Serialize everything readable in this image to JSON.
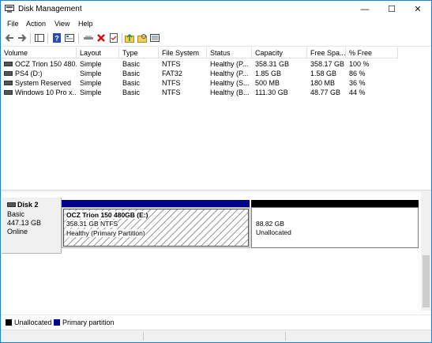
{
  "window": {
    "title": "Disk Management",
    "controls": {
      "minimize": "—",
      "maximize": "☐",
      "close": "✕"
    }
  },
  "menu": [
    "File",
    "Action",
    "View",
    "Help"
  ],
  "toolbar": {
    "icons": [
      "back-icon",
      "forward-icon",
      "show-hide-console-tree-icon",
      "help-icon",
      "properties-icon",
      "connect-icon",
      "delete-icon",
      "check-icon",
      "folder-up-icon",
      "folder-search-icon",
      "list-icon"
    ]
  },
  "table": {
    "columns": [
      "Volume",
      "Layout",
      "Type",
      "File System",
      "Status",
      "Capacity",
      "Free Spa...",
      "% Free"
    ],
    "rows": [
      {
        "volume": "OCZ Trion 150 480...",
        "layout": "Simple",
        "type": "Basic",
        "fs": "NTFS",
        "status": "Healthy (P...",
        "capacity": "358.31 GB",
        "free": "358.17 GB",
        "pct": "100 %"
      },
      {
        "volume": "PS4 (D:)",
        "layout": "Simple",
        "type": "Basic",
        "fs": "FAT32",
        "status": "Healthy (P...",
        "capacity": "1.85 GB",
        "free": "1.58 GB",
        "pct": "86 %"
      },
      {
        "volume": "System Reserved",
        "layout": "Simple",
        "type": "Basic",
        "fs": "NTFS",
        "status": "Healthy (S...",
        "capacity": "500 MB",
        "free": "180 MB",
        "pct": "36 %"
      },
      {
        "volume": "Windows 10 Pro x...",
        "layout": "Simple",
        "type": "Basic",
        "fs": "NTFS",
        "status": "Healthy (B...",
        "capacity": "111.30 GB",
        "free": "48.77 GB",
        "pct": "44 %"
      }
    ]
  },
  "disk": {
    "name": "Disk 2",
    "type": "Basic",
    "size": "447.13 GB",
    "state": "Online",
    "partitions": [
      {
        "title": "OCZ Trion 150 480GB  (E:)",
        "size_fs": "358.31 GB NTFS",
        "status": "Healthy (Primary Partition)"
      },
      {
        "size": "88.82 GB",
        "label": "Unallocated"
      }
    ]
  },
  "legend": [
    {
      "label": "Unallocated",
      "color": "#000000"
    },
    {
      "label": "Primary partition",
      "color": "#00008b"
    }
  ],
  "colors": {
    "primary": "#00008b",
    "unallocated": "#000000",
    "border": "#1883d7"
  }
}
